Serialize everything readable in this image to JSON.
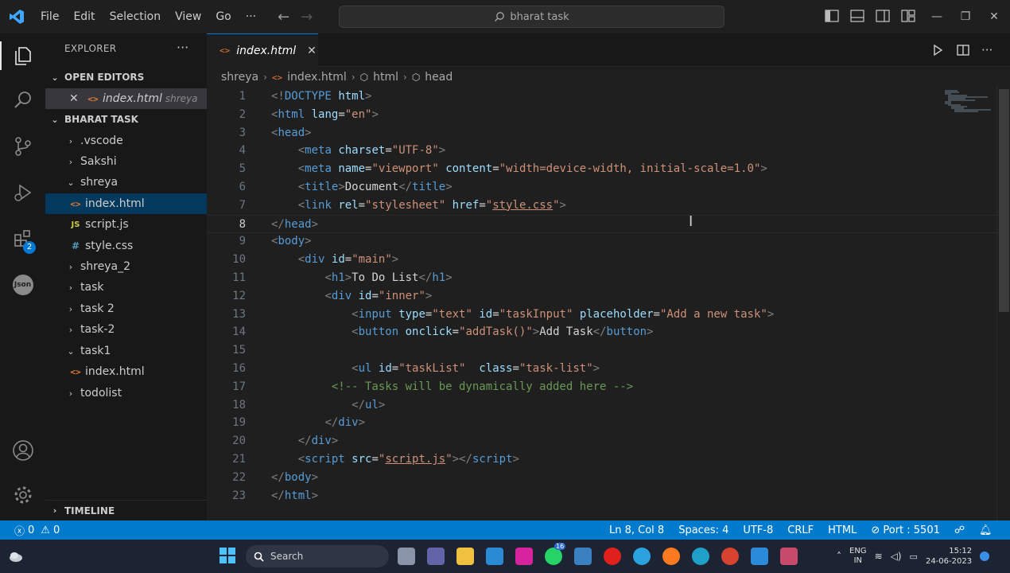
{
  "menu": [
    "File",
    "Edit",
    "Selection",
    "View",
    "Go",
    "···"
  ],
  "command_center": {
    "text": "bharat task"
  },
  "activity": {
    "extensions_badge": "2",
    "json_label": "Json"
  },
  "explorer": {
    "title": "EXPLORER",
    "more": "···",
    "open_editors": {
      "title": "OPEN EDITORS",
      "file": "index.html",
      "folder": "shreya"
    },
    "workspace": "BHARAT TASK",
    "tree": [
      {
        "label": ".vscode",
        "kind": "folder",
        "open": false
      },
      {
        "label": "Sakshi",
        "kind": "folder",
        "open": false
      },
      {
        "label": "shreya",
        "kind": "folder",
        "open": true
      },
      {
        "label": "index.html",
        "kind": "html",
        "selected": true
      },
      {
        "label": "script.js",
        "kind": "js"
      },
      {
        "label": "style.css",
        "kind": "css"
      },
      {
        "label": "shreya_2",
        "kind": "folder",
        "open": false
      },
      {
        "label": "task",
        "kind": "folder",
        "open": false
      },
      {
        "label": "task 2",
        "kind": "folder",
        "open": false
      },
      {
        "label": "task-2",
        "kind": "folder",
        "open": false
      },
      {
        "label": "task1",
        "kind": "folder",
        "open": true
      },
      {
        "label": "index.html",
        "kind": "html"
      },
      {
        "label": "todolist",
        "kind": "folder",
        "open": false
      }
    ],
    "timeline": "TIMELINE"
  },
  "tab": {
    "label": "index.html"
  },
  "breadcrumb": [
    "shreya",
    "index.html",
    "html",
    "head"
  ],
  "editor": {
    "current_line": 8,
    "lines": [
      [
        [
          "g",
          "<!"
        ],
        [
          "t",
          "DOCTYPE"
        ],
        [
          "x",
          " "
        ],
        [
          "a",
          "html"
        ],
        [
          "g",
          ">"
        ]
      ],
      [
        [
          "g",
          "<"
        ],
        [
          "t",
          "html"
        ],
        [
          "x",
          " "
        ],
        [
          "a",
          "lang"
        ],
        [
          "x",
          "="
        ],
        [
          "s",
          "\"en\""
        ],
        [
          "g",
          ">"
        ]
      ],
      [
        [
          "g",
          "<"
        ],
        [
          "t",
          "head"
        ],
        [
          "g",
          ">"
        ]
      ],
      [
        [
          "x",
          "    "
        ],
        [
          "g",
          "<"
        ],
        [
          "t",
          "meta"
        ],
        [
          "x",
          " "
        ],
        [
          "a",
          "charset"
        ],
        [
          "x",
          "="
        ],
        [
          "s",
          "\"UTF-8\""
        ],
        [
          "g",
          ">"
        ]
      ],
      [
        [
          "x",
          "    "
        ],
        [
          "g",
          "<"
        ],
        [
          "t",
          "meta"
        ],
        [
          "x",
          " "
        ],
        [
          "a",
          "name"
        ],
        [
          "x",
          "="
        ],
        [
          "s",
          "\"viewport\""
        ],
        [
          "x",
          " "
        ],
        [
          "a",
          "content"
        ],
        [
          "x",
          "="
        ],
        [
          "s",
          "\"width=device-width, initial-scale=1.0\""
        ],
        [
          "g",
          ">"
        ]
      ],
      [
        [
          "x",
          "    "
        ],
        [
          "g",
          "<"
        ],
        [
          "t",
          "title"
        ],
        [
          "g",
          ">"
        ],
        [
          "x",
          "Document"
        ],
        [
          "g",
          "</"
        ],
        [
          "t",
          "title"
        ],
        [
          "g",
          ">"
        ]
      ],
      [
        [
          "x",
          "    "
        ],
        [
          "g",
          "<"
        ],
        [
          "t",
          "link"
        ],
        [
          "x",
          " "
        ],
        [
          "a",
          "rel"
        ],
        [
          "x",
          "="
        ],
        [
          "s",
          "\"stylesheet\""
        ],
        [
          "x",
          " "
        ],
        [
          "a",
          "href"
        ],
        [
          "x",
          "="
        ],
        [
          "s",
          "\""
        ],
        [
          "su",
          "style.css"
        ],
        [
          "s",
          "\""
        ],
        [
          "g",
          ">"
        ]
      ],
      [
        [
          "g",
          "</"
        ],
        [
          "t",
          "head"
        ],
        [
          "g",
          ">"
        ]
      ],
      [
        [
          "g",
          "<"
        ],
        [
          "t",
          "body"
        ],
        [
          "g",
          ">"
        ]
      ],
      [
        [
          "x",
          "    "
        ],
        [
          "g",
          "<"
        ],
        [
          "t",
          "div"
        ],
        [
          "x",
          " "
        ],
        [
          "a",
          "id"
        ],
        [
          "x",
          "="
        ],
        [
          "s",
          "\"main\""
        ],
        [
          "g",
          ">"
        ]
      ],
      [
        [
          "x",
          "        "
        ],
        [
          "g",
          "<"
        ],
        [
          "t",
          "h1"
        ],
        [
          "g",
          ">"
        ],
        [
          "x",
          "To Do List"
        ],
        [
          "g",
          "</"
        ],
        [
          "t",
          "h1"
        ],
        [
          "g",
          ">"
        ]
      ],
      [
        [
          "x",
          "        "
        ],
        [
          "g",
          "<"
        ],
        [
          "t",
          "div"
        ],
        [
          "x",
          " "
        ],
        [
          "a",
          "id"
        ],
        [
          "x",
          "="
        ],
        [
          "s",
          "\"inner\""
        ],
        [
          "g",
          ">"
        ]
      ],
      [
        [
          "x",
          "            "
        ],
        [
          "g",
          "<"
        ],
        [
          "t",
          "input"
        ],
        [
          "x",
          " "
        ],
        [
          "a",
          "type"
        ],
        [
          "x",
          "="
        ],
        [
          "s",
          "\"text\""
        ],
        [
          "x",
          " "
        ],
        [
          "a",
          "id"
        ],
        [
          "x",
          "="
        ],
        [
          "s",
          "\"taskInput\""
        ],
        [
          "x",
          " "
        ],
        [
          "a",
          "placeholder"
        ],
        [
          "x",
          "="
        ],
        [
          "s",
          "\"Add a new task\""
        ],
        [
          "g",
          ">"
        ]
      ],
      [
        [
          "x",
          "            "
        ],
        [
          "g",
          "<"
        ],
        [
          "t",
          "button"
        ],
        [
          "x",
          " "
        ],
        [
          "a",
          "onclick"
        ],
        [
          "x",
          "="
        ],
        [
          "s",
          "\"addTask()\""
        ],
        [
          "g",
          ">"
        ],
        [
          "x",
          "Add Task"
        ],
        [
          "g",
          "</"
        ],
        [
          "t",
          "button"
        ],
        [
          "g",
          ">"
        ]
      ],
      [
        [
          "x",
          ""
        ]
      ],
      [
        [
          "x",
          "            "
        ],
        [
          "g",
          "<"
        ],
        [
          "t",
          "ul"
        ],
        [
          "x",
          " "
        ],
        [
          "a",
          "id"
        ],
        [
          "x",
          "="
        ],
        [
          "s",
          "\"taskList\""
        ],
        [
          "x",
          "  "
        ],
        [
          "a",
          "class"
        ],
        [
          "x",
          "="
        ],
        [
          "s",
          "\"task-list\""
        ],
        [
          "g",
          ">"
        ]
      ],
      [
        [
          "x",
          "         "
        ],
        [
          "c",
          "<!-- Tasks will be dynamically added here -->"
        ]
      ],
      [
        [
          "x",
          "            "
        ],
        [
          "g",
          "</"
        ],
        [
          "t",
          "ul"
        ],
        [
          "g",
          ">"
        ]
      ],
      [
        [
          "x",
          "        "
        ],
        [
          "g",
          "</"
        ],
        [
          "t",
          "div"
        ],
        [
          "g",
          ">"
        ]
      ],
      [
        [
          "x",
          "    "
        ],
        [
          "g",
          "</"
        ],
        [
          "t",
          "div"
        ],
        [
          "g",
          ">"
        ]
      ],
      [
        [
          "x",
          "    "
        ],
        [
          "g",
          "<"
        ],
        [
          "t",
          "script"
        ],
        [
          "x",
          " "
        ],
        [
          "a",
          "src"
        ],
        [
          "x",
          "="
        ],
        [
          "s",
          "\""
        ],
        [
          "su",
          "script.js"
        ],
        [
          "s",
          "\""
        ],
        [
          "g",
          "></"
        ],
        [
          "t",
          "script"
        ],
        [
          "g",
          ">"
        ]
      ],
      [
        [
          "g",
          "</"
        ],
        [
          "t",
          "body"
        ],
        [
          "g",
          ">"
        ]
      ],
      [
        [
          "g",
          "</"
        ],
        [
          "t",
          "html"
        ],
        [
          "g",
          ">"
        ]
      ]
    ]
  },
  "status": {
    "errors": "0",
    "warnings": "0",
    "position": "Ln 8, Col 8",
    "spaces": "Spaces: 4",
    "encoding": "UTF-8",
    "eol": "CRLF",
    "language": "HTML",
    "port": "Port : 5501"
  },
  "taskbar": {
    "search": "Search",
    "lang_top": "ENG",
    "lang_bottom": "IN",
    "time": "15:12",
    "date": "24-06-2023",
    "whatsapp_badge": "16"
  },
  "colors": {
    "accent": "#007acc",
    "selection": "#37373d",
    "tag": "#569cd6",
    "attr": "#9cdcfe",
    "string": "#ce9178",
    "comment": "#6a9955"
  }
}
